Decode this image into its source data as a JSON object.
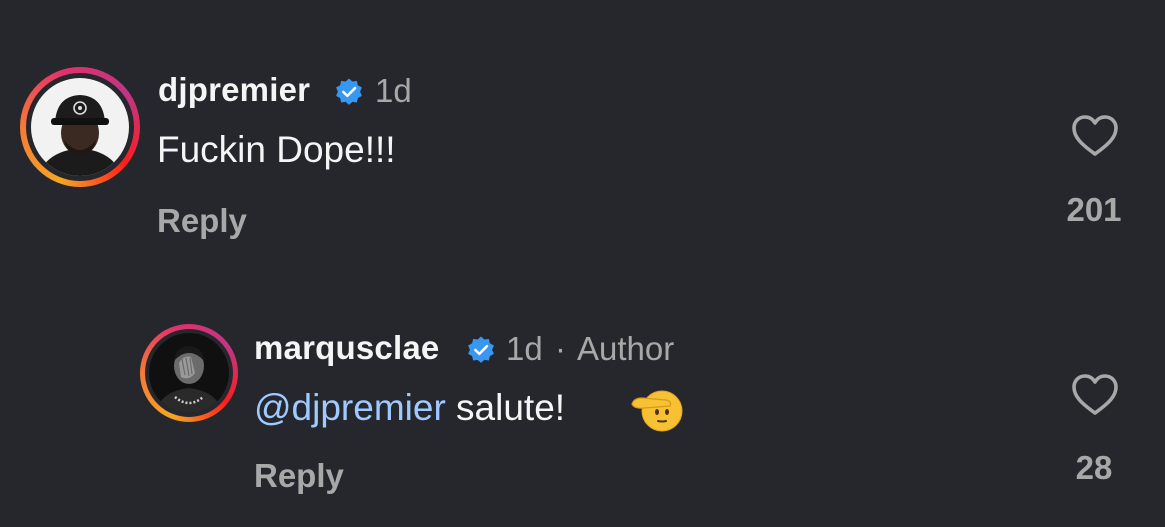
{
  "comments": [
    {
      "username": "djpremier",
      "time": "1d",
      "text": "Fuckin Dope!!!",
      "reply_label": "Reply",
      "like_count": "201"
    },
    {
      "username": "marqusclae",
      "time": "1d",
      "separator": "·",
      "author_label": "Author",
      "mention": "@djpremier",
      "text": " salute!",
      "reply_label": "Reply",
      "like_count": "28"
    }
  ],
  "colors": {
    "background": "#25272c",
    "verified": "#3897f0",
    "mention": "#9fc9ff",
    "muted": "#a8a8a8"
  },
  "icons": {
    "verified": "verified-badge-icon",
    "heart": "heart-outline-icon",
    "emoji": "saluting-face-emoji"
  }
}
